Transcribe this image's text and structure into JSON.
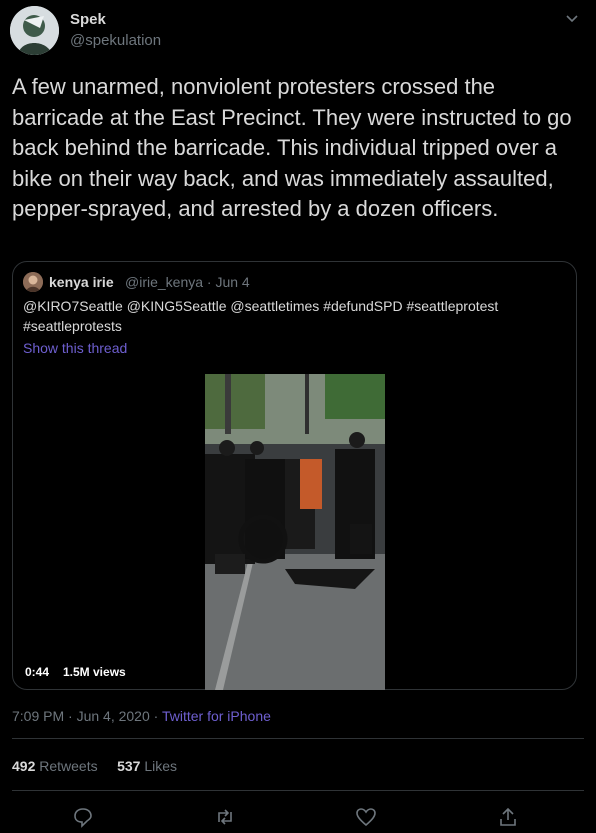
{
  "author": {
    "name": "Spek",
    "handle": "@spekulation"
  },
  "tweet_text": "A few unarmed, nonviolent protesters crossed the barricade at the East Precinct. They were instructed to go back behind the barricade. This individual tripped over a bike on their way back, and was immediately assaulted, pepper-sprayed, and arrested by a dozen officers.",
  "quoted": {
    "name": "kenya irie",
    "meta": "@irie_kenya · Jun 4",
    "text": "@KIRO7Seattle @KING5Seattle @seattletimes #defundSPD #seattleprotest #seattleprotests",
    "show_thread": "Show this thread",
    "video_time": "0:44",
    "video_views": "1.5M views"
  },
  "timestamp": {
    "time": "7:09 PM · Jun 4, 2020 · ",
    "source": "Twitter for iPhone"
  },
  "stats": {
    "retweets_count": "492",
    "retweets_label": "Retweets",
    "likes_count": "537",
    "likes_label": "Likes"
  },
  "icons": [
    "chevron-down-icon",
    "reply-icon",
    "retweet-icon",
    "like-icon",
    "share-icon"
  ],
  "colors": {
    "background": "#000000",
    "text": "#d9d9d9",
    "muted": "#6e767d",
    "link": "#6e5fd0",
    "border": "#2f3336"
  }
}
